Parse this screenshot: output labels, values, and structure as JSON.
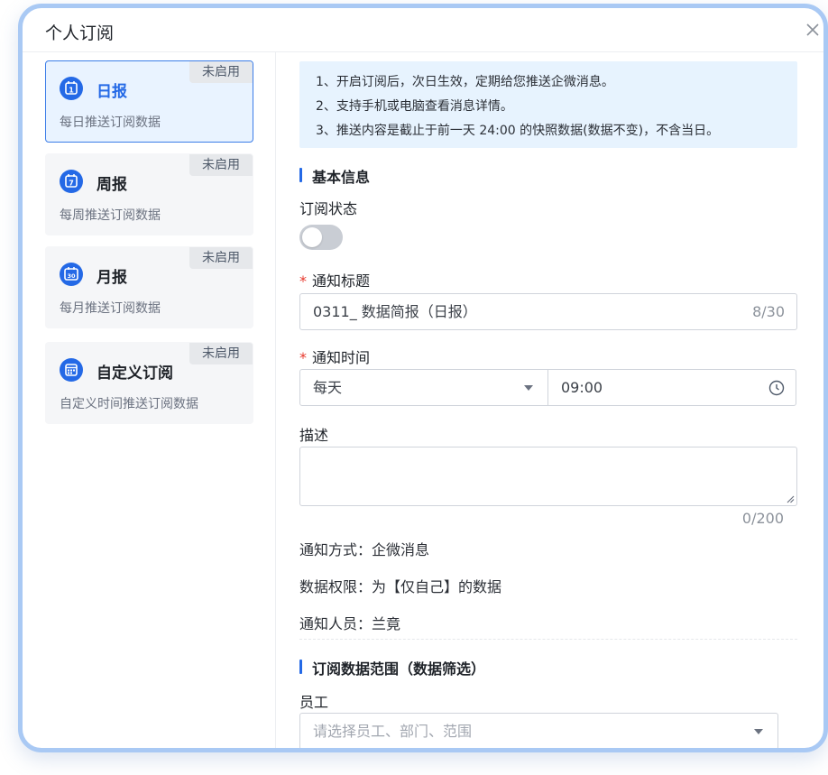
{
  "dialog": {
    "title": "个人订阅",
    "close_icon": "close-icon"
  },
  "sidebar": {
    "cards": [
      {
        "name": "日报",
        "desc": "每日推送订阅数据",
        "badge": "未启用",
        "icon": "calendar-1-icon",
        "icon_text": "1",
        "active": true
      },
      {
        "name": "周报",
        "desc": "每周推送订阅数据",
        "badge": "未启用",
        "icon": "calendar-7-icon",
        "icon_text": "7",
        "active": false
      },
      {
        "name": "月报",
        "desc": "每月推送订阅数据",
        "badge": "未启用",
        "icon": "calendar-30-icon",
        "icon_text": "30",
        "active": false
      },
      {
        "name": "自定义订阅",
        "desc": "自定义时间推送订阅数据",
        "badge": "未启用",
        "icon": "calendar-grid-icon",
        "icon_text": "",
        "active": false
      }
    ]
  },
  "tips": [
    "1、开启订阅后，次日生效，定期给您推送企微消息。",
    "2、支持手机或电脑查看消息详情。",
    "3、推送内容是截止于前一天 24:00 的快照数据(数据不变)，不含当日。"
  ],
  "basic": {
    "section_title": "基本信息",
    "status_label": "订阅状态",
    "status_on": false,
    "title_label": "通知标题",
    "title_value": "0311_ 数据简报（日报）",
    "title_counter": "8/30",
    "time_label": "通知时间",
    "frequency_value": "每天",
    "time_value": "09:00",
    "desc_label": "描述",
    "desc_value": "",
    "desc_counter": "0/200",
    "notify_method": "通知方式：企微消息",
    "data_permission": "数据权限：为【仅自己】的数据",
    "notify_people": "通知人员：兰竟"
  },
  "scope": {
    "section_title": "订阅数据范围（数据筛选）",
    "employee_label": "员工",
    "employee_placeholder": "请选择员工、部门、范围"
  },
  "colors": {
    "primary": "#2469e6",
    "tip_bg": "#e7f3fe",
    "required": "#e8382c",
    "frame_border": "#a9c9f4"
  }
}
